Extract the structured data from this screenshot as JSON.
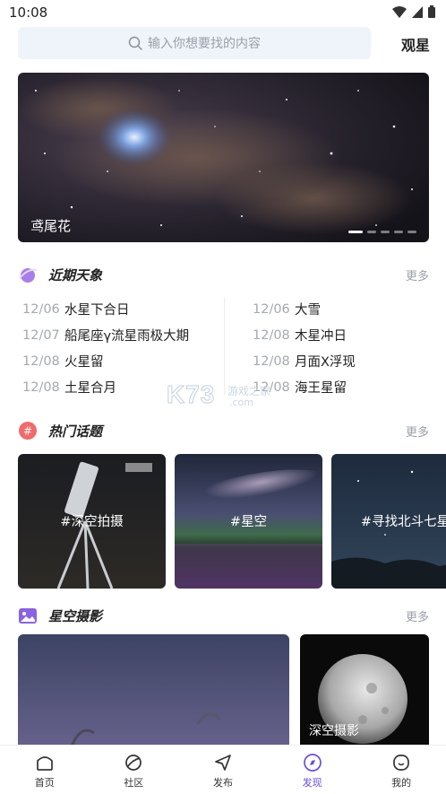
{
  "status_bar": {
    "time": "10:08"
  },
  "search": {
    "placeholder": "输入你想要找的内容",
    "side_link": "观星"
  },
  "banner": {
    "caption": "鸢尾花",
    "dots": 5,
    "active_dot": 0
  },
  "celestial": {
    "title": "近期天象",
    "more": "更多",
    "left": [
      {
        "date": "12/06",
        "text": "水星下合日"
      },
      {
        "date": "12/07",
        "text": "船尾座γ流星雨极大期"
      },
      {
        "date": "12/08",
        "text": "火星留"
      },
      {
        "date": "12/08",
        "text": "土星合月"
      }
    ],
    "right": [
      {
        "date": "12/06",
        "text": "大雪"
      },
      {
        "date": "12/08",
        "text": "木星冲日"
      },
      {
        "date": "12/08",
        "text": "月面X浮现"
      },
      {
        "date": "12/08",
        "text": "海王星留"
      }
    ]
  },
  "topics": {
    "title": "热门话题",
    "more": "更多",
    "cards": [
      {
        "label": "#深空拍摄"
      },
      {
        "label": "#星空"
      },
      {
        "label": "#寻找北斗七星"
      }
    ]
  },
  "photography": {
    "title": "星空摄影",
    "more": "更多",
    "cards": [
      {
        "label": ""
      },
      {
        "label": "深空摄影"
      }
    ]
  },
  "watermark": {
    "brand": "K73",
    "cn": "游戏之家",
    "domain": ".com"
  },
  "tabbar": {
    "tabs": [
      {
        "label": "首页",
        "icon": "home-icon"
      },
      {
        "label": "社区",
        "icon": "planet-icon"
      },
      {
        "label": "发布",
        "icon": "send-icon"
      },
      {
        "label": "发现",
        "icon": "compass-icon",
        "active": true
      },
      {
        "label": "我的",
        "icon": "smile-icon"
      }
    ]
  },
  "colors": {
    "accent": "#6a4fd8",
    "muted": "#9aa0a8",
    "search_bg": "#eff3fa"
  }
}
